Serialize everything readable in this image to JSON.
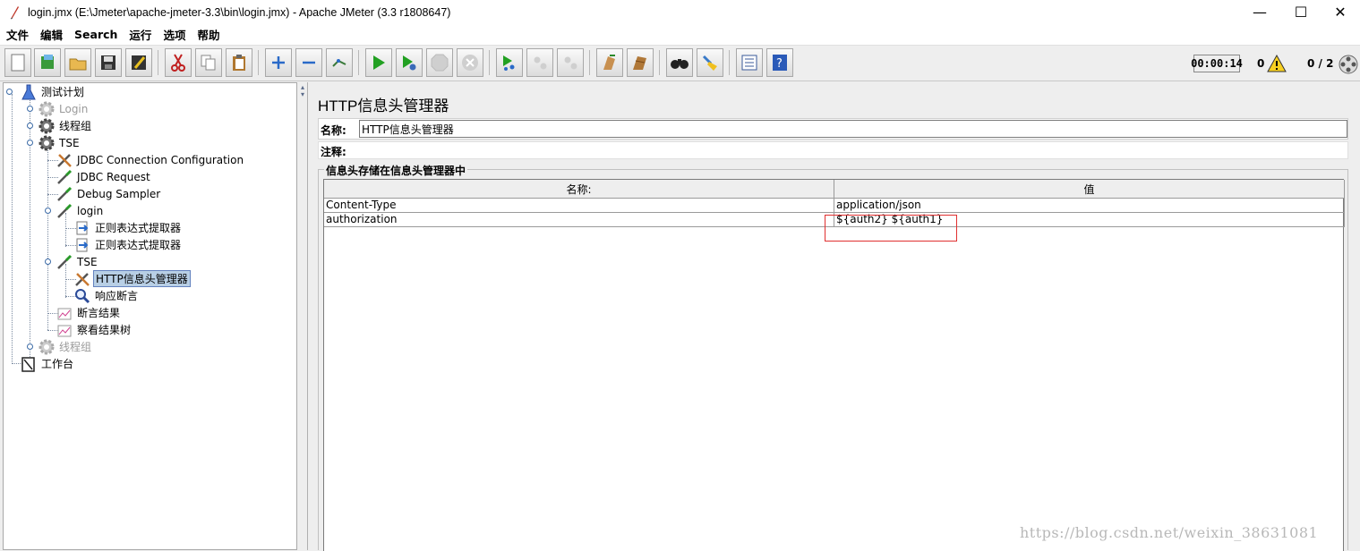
{
  "window": {
    "title": "login.jmx (E:\\Jmeter\\apache-jmeter-3.3\\bin\\login.jmx) - Apache JMeter (3.3 r1808647)",
    "minimize": "—",
    "maximize": "☐",
    "close": "✕"
  },
  "menu": [
    "文件",
    "编辑",
    "Search",
    "运行",
    "选项",
    "帮助"
  ],
  "toolbar": {
    "icons": [
      "new-icon",
      "templates-icon",
      "open-icon",
      "save-icon",
      "save-as-icon",
      "cut-icon",
      "copy-icon",
      "paste-icon",
      "expand-icon",
      "collapse-icon",
      "toggle-icon",
      "start-icon",
      "start-no-pause-icon",
      "stop-icon",
      "shutdown-icon",
      "remote-start-icon",
      "remote-stop-icon",
      "remote-shutdown-icon",
      "clear-icon",
      "clear-all-icon",
      "search-icon",
      "reset-search-icon",
      "function-helper-icon",
      "help-icon"
    ],
    "timer": "00:00:14",
    "error_count": "0",
    "threads": "0 / 2"
  },
  "tree": {
    "nodes": [
      {
        "label": "测试计划",
        "icon": "test-plan-icon"
      },
      {
        "label": "Login",
        "icon": "thread-group-icon",
        "disabled": true
      },
      {
        "label": "线程组",
        "icon": "thread-group-icon"
      },
      {
        "label": "TSE",
        "icon": "thread-group-icon"
      },
      {
        "label": "JDBC Connection Configuration",
        "icon": "config-icon"
      },
      {
        "label": "JDBC Request",
        "icon": "sampler-icon"
      },
      {
        "label": "Debug Sampler",
        "icon": "sampler-icon"
      },
      {
        "label": "login",
        "icon": "sampler-icon"
      },
      {
        "label": "正则表达式提取器",
        "icon": "post-processor-icon"
      },
      {
        "label": "正则表达式提取器",
        "icon": "post-processor-icon"
      },
      {
        "label": "TSE",
        "icon": "sampler-icon"
      },
      {
        "label": "HTTP信息头管理器",
        "icon": "config-icon",
        "selected": true
      },
      {
        "label": "响应断言",
        "icon": "assertion-icon"
      },
      {
        "label": "断言结果",
        "icon": "listener-icon"
      },
      {
        "label": "察看结果树",
        "icon": "listener-icon"
      },
      {
        "label": "线程组",
        "icon": "thread-group-icon",
        "disabled": true
      },
      {
        "label": "工作台",
        "icon": "workbench-icon"
      }
    ]
  },
  "panel": {
    "title": "HTTP信息头管理器",
    "name_label": "名称:",
    "name_value": "HTTP信息头管理器",
    "comment_label": "注释:",
    "comment_value": "",
    "group_title": "信息头存储在信息头管理器中",
    "columns": [
      "名称:",
      "值"
    ],
    "rows": [
      {
        "name": "Content-Type",
        "value": "application/json"
      },
      {
        "name": "authorization",
        "value": "${auth2} ${auth1}"
      }
    ]
  },
  "colors": {
    "selection": "#b8cfe5",
    "annotation": "#e03030"
  },
  "watermark": "https://blog.csdn.net/weixin_38631081"
}
